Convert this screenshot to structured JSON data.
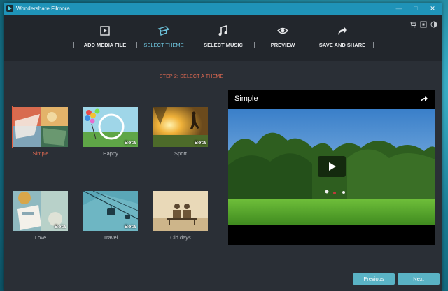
{
  "window": {
    "title": "Wondershare Filmora"
  },
  "steps": [
    {
      "label": "ADD MEDIA FILE",
      "icon": "import-media-icon"
    },
    {
      "label": "SELECT THEME",
      "icon": "theme-icon"
    },
    {
      "label": "SELECT MUSIC",
      "icon": "music-note-icon"
    },
    {
      "label": "PREVIEW",
      "icon": "eye-icon"
    },
    {
      "label": "SAVE AND SHARE",
      "icon": "share-arrow-icon"
    }
  ],
  "active_step": 1,
  "header_icons": [
    "cart-icon",
    "register-icon",
    "theme-toggle-icon"
  ],
  "main": {
    "step_title": "STEP 2: SELECT A THEME"
  },
  "themes": [
    {
      "label": "Simple",
      "beta": "",
      "selected": true
    },
    {
      "label": "Happy",
      "beta": "Beta",
      "selected": false
    },
    {
      "label": "Sport",
      "beta": "Beta",
      "selected": false
    },
    {
      "label": "Love",
      "beta": "Beta",
      "selected": false
    },
    {
      "label": "Travel",
      "beta": "Beta",
      "selected": false
    },
    {
      "label": "Old days",
      "beta": "",
      "selected": false
    }
  ],
  "preview": {
    "title": "Simple"
  },
  "nav": {
    "previous": "Previous",
    "next": "Next"
  },
  "colors": {
    "accent": "#5ab3c5",
    "selected": "#e45c3d",
    "titlebar": "#1f93b8"
  }
}
